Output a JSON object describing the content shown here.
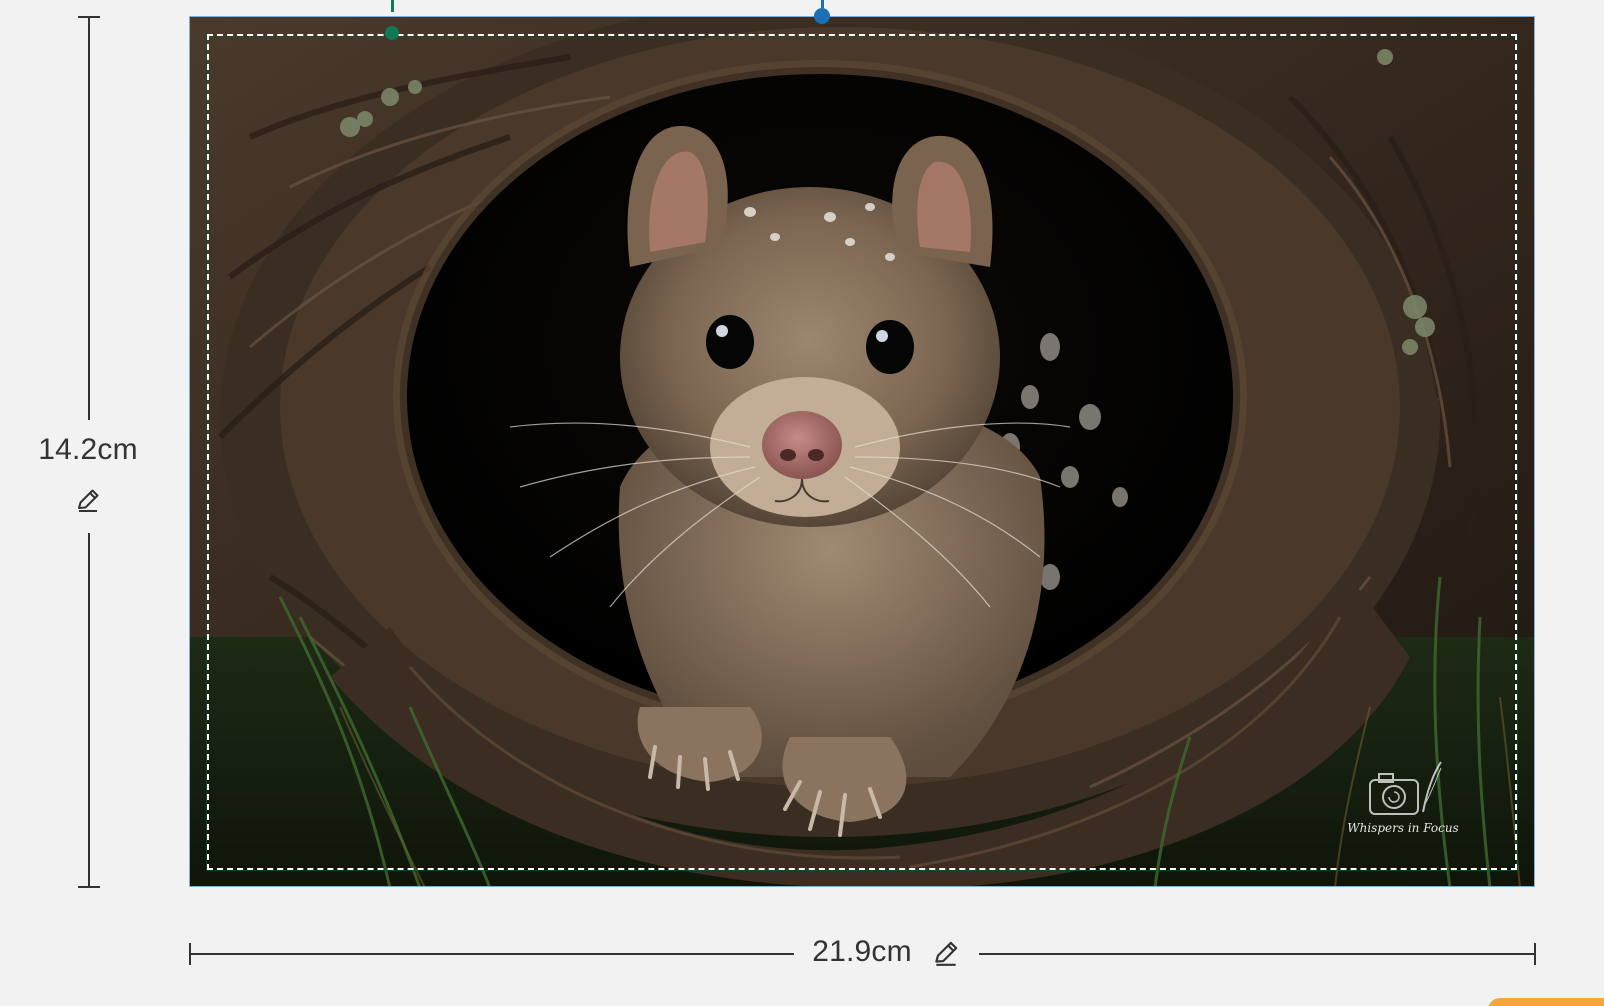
{
  "dimensions": {
    "height_label": "14.2cm",
    "width_label": "21.9cm"
  },
  "icons": {
    "height_edit": "pencil-icon",
    "width_edit": "pencil-icon"
  },
  "image": {
    "alt": "Spotted quoll peeking out of a hollow log",
    "watermark_text": "Whispers in Focus"
  },
  "colors": {
    "frame_border": "#7fb0d8",
    "crop_handle": "#0f7a55",
    "rotate_handle": "#1b6fb3",
    "accent_tab": "#f3a63b"
  }
}
